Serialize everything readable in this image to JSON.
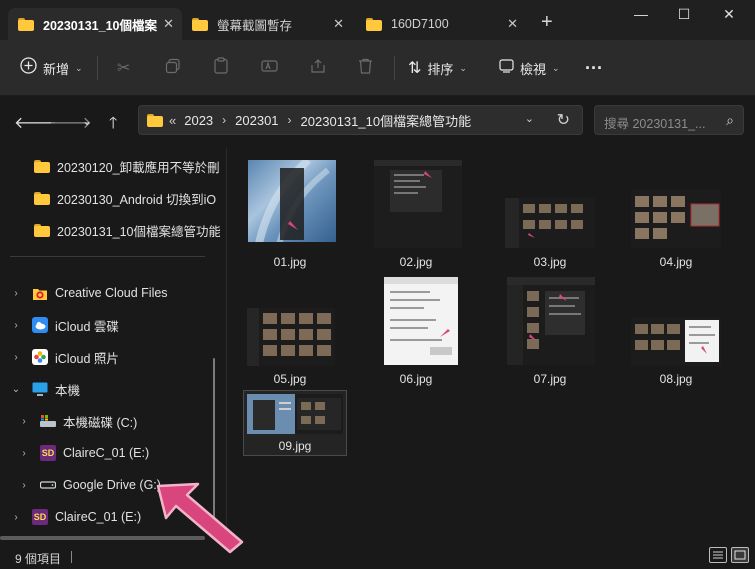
{
  "tabs": [
    {
      "label": "20230131_10個檔案",
      "active": true
    },
    {
      "label": "螢幕截圖暫存",
      "active": false
    },
    {
      "label": "160D7100",
      "active": false
    }
  ],
  "window": {
    "new_tab": "+",
    "minimize": "—",
    "maximize": "☐",
    "close": "✕"
  },
  "toolbar": {
    "new_label": "新增",
    "sort_label": "排序",
    "view_label": "檢視",
    "more": "···"
  },
  "address": {
    "overflow": "«",
    "crumbs": [
      "2023",
      "202301",
      "20230131_10個檔案總管功能"
    ]
  },
  "search": {
    "placeholder": "搜尋 20230131_..."
  },
  "sidebar": {
    "folders": [
      "20230120_卸載應用不等於刪",
      "20230130_Android 切換到iO",
      "20230131_10個檔案總管功能"
    ],
    "items": [
      {
        "label": "Creative Cloud Files",
        "icon": "creative-cloud-icon"
      },
      {
        "label": "iCloud 雲碟",
        "icon": "icloud-drive-icon"
      },
      {
        "label": "iCloud 照片",
        "icon": "icloud-photos-icon"
      },
      {
        "label": "本機",
        "icon": "this-pc-icon"
      },
      {
        "label": "本機磁碟 (C:)",
        "icon": "local-disk-icon"
      },
      {
        "label": "ClaireC_01 (E:)",
        "icon": "sd-card-icon"
      },
      {
        "label": "Google Drive (G:)",
        "icon": "drive-icon"
      },
      {
        "label": "ClaireC_01 (E:)",
        "icon": "sd-card-icon"
      }
    ],
    "sd_badge": "SD"
  },
  "files": [
    "01.jpg",
    "02.jpg",
    "03.jpg",
    "04.jpg",
    "05.jpg",
    "06.jpg",
    "07.jpg",
    "08.jpg",
    "09.jpg"
  ],
  "status": {
    "count": "9 個項目"
  },
  "colors": {
    "accent_arrow": "#d9467e",
    "folder": "#ffc83d",
    "background": "#191919"
  }
}
